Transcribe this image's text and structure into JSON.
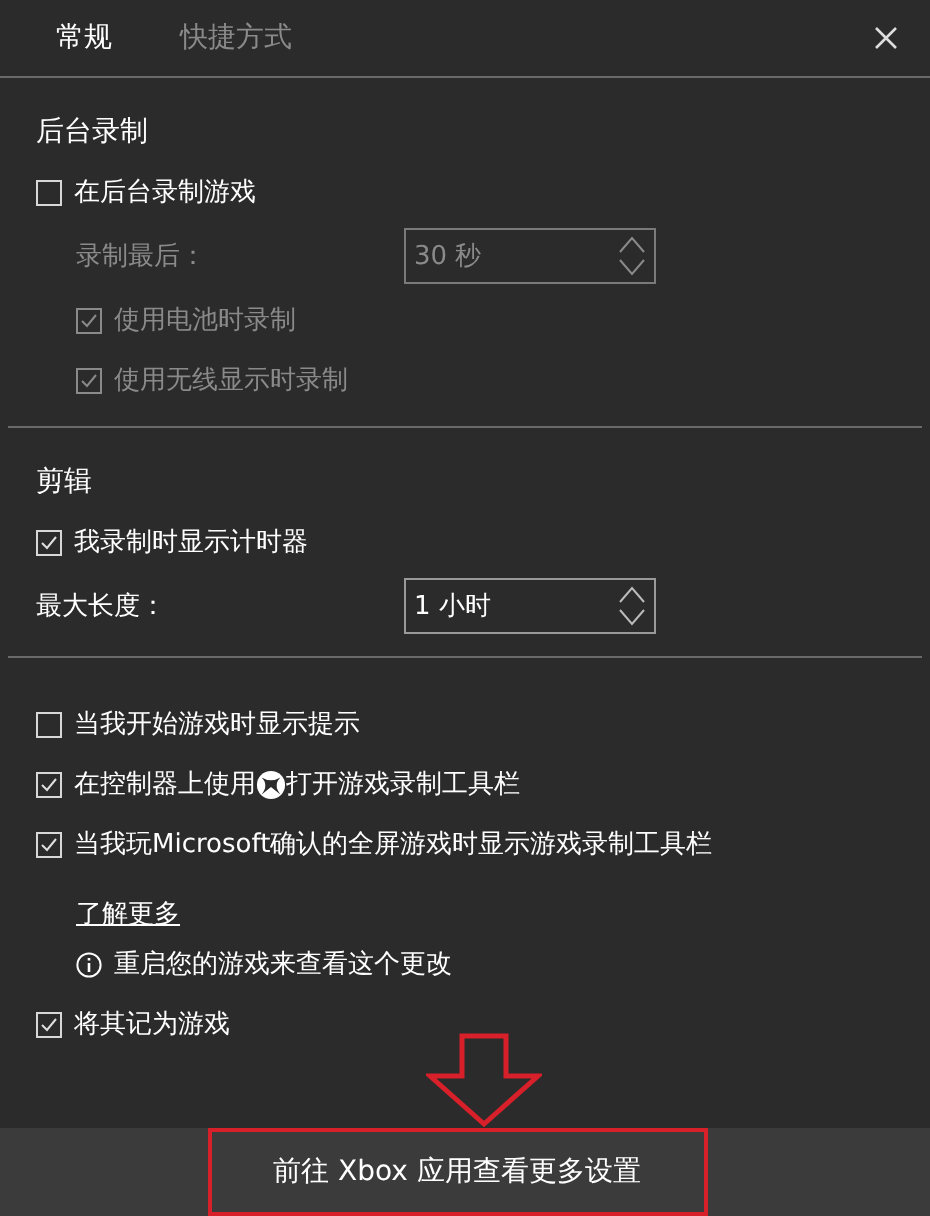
{
  "tabs": [
    {
      "label": "常规",
      "selected": true
    },
    {
      "label": "快捷方式",
      "selected": false
    }
  ],
  "sections": [
    {
      "title": "后台录制",
      "items": [
        {
          "kind": "checkbox",
          "label": "在后台录制游戏",
          "checked": false,
          "disabled": false,
          "indented": false
        },
        {
          "kind": "spinner",
          "label": "录制最后：",
          "value": "30 秒",
          "disabled": true,
          "indented": true
        },
        {
          "kind": "checkbox",
          "label": "使用电池时录制",
          "checked": true,
          "disabled": true,
          "indented": true
        },
        {
          "kind": "checkbox",
          "label": "使用无线显示时录制",
          "checked": true,
          "disabled": true,
          "indented": true
        }
      ]
    },
    {
      "title": "剪辑",
      "items": [
        {
          "kind": "checkbox",
          "label": "我录制时显示计时器",
          "checked": true,
          "disabled": false,
          "indented": false
        },
        {
          "kind": "spinner",
          "label": "最大长度：",
          "value": "1 小时",
          "disabled": false,
          "indented": false
        }
      ]
    },
    {
      "items": [
        {
          "kind": "checkbox",
          "label": "当我开始游戏时显示提示",
          "checked": false,
          "disabled": false,
          "indented": false
        },
        {
          "kind": "checkbox_icon",
          "label": "在控制器上使用",
          "label_after": "打开游戏录制工具栏",
          "checked": true,
          "disabled": false,
          "indented": false
        },
        {
          "kind": "checkbox",
          "label": "当我玩Microsoft确认的全屏游戏时显示游戏录制工具栏",
          "checked": true,
          "disabled": false,
          "indented": false
        },
        {
          "kind": "link",
          "label": "了解更多",
          "indented": true
        },
        {
          "kind": "info",
          "label": "重启您的游戏来查看这个更改",
          "indented": true
        },
        {
          "kind": "checkbox",
          "label": "将其记为游戏",
          "checked": true,
          "disabled": false,
          "indented": false
        }
      ]
    }
  ],
  "footer_button": "前往 Xbox 应用查看更多设置"
}
